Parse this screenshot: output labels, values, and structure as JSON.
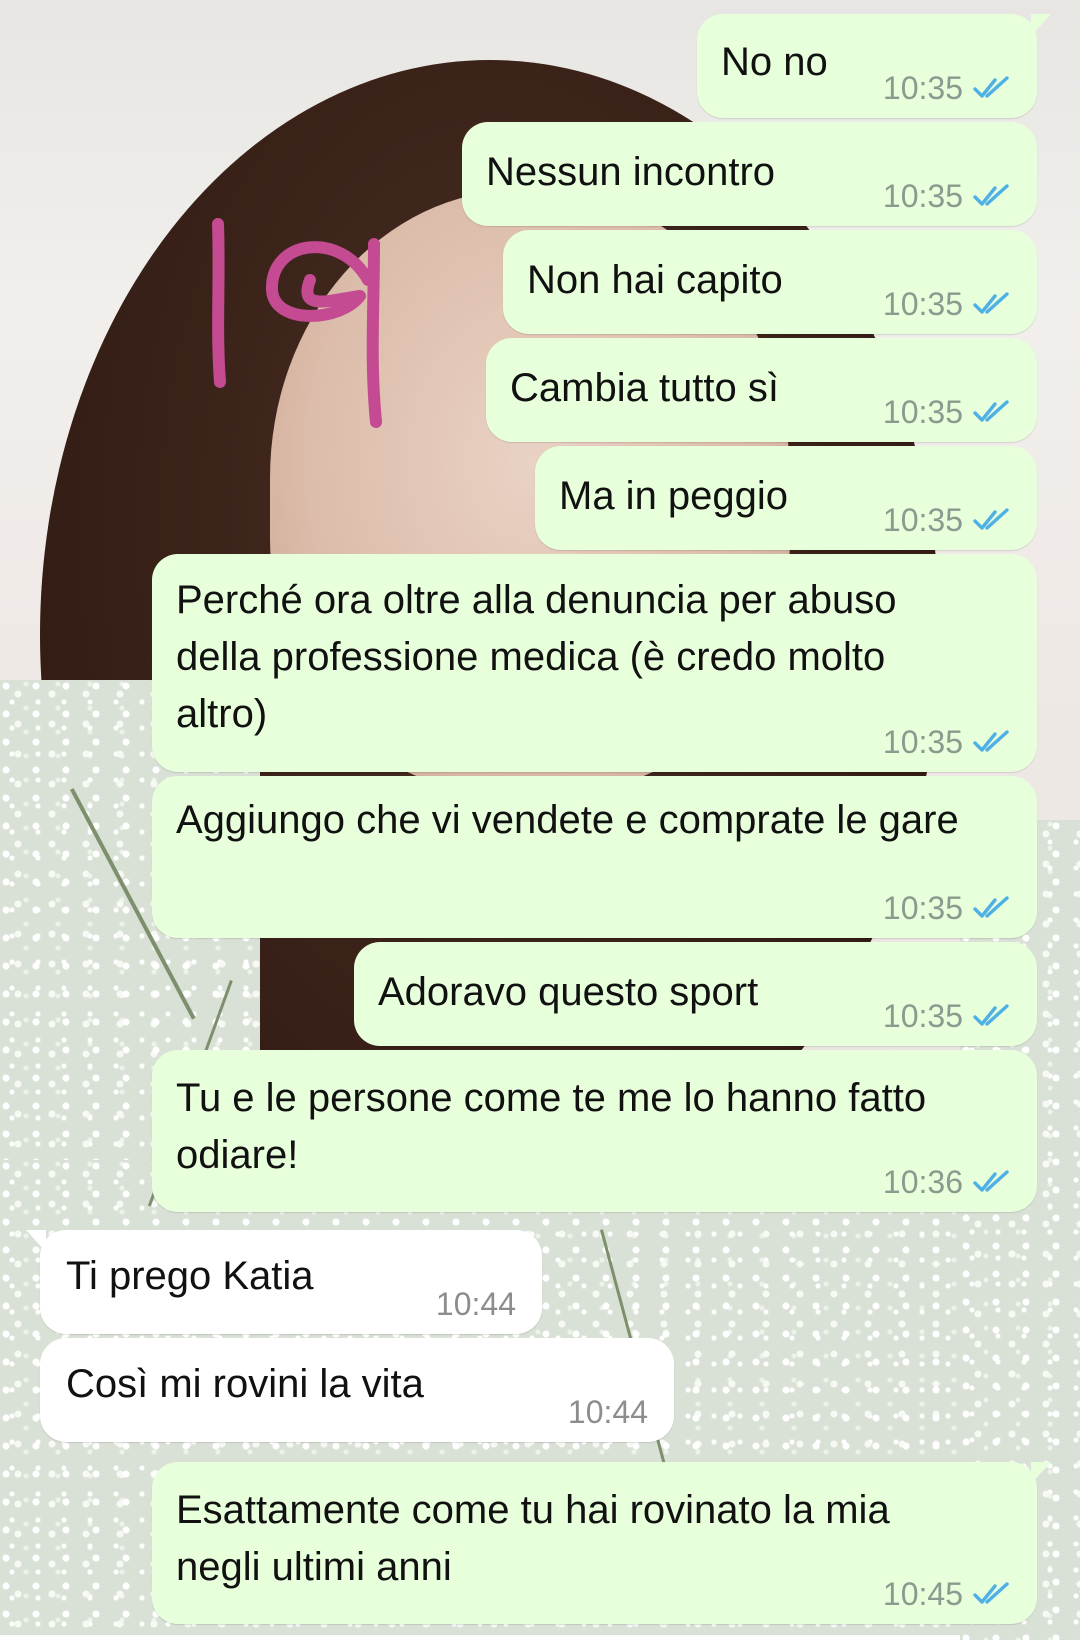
{
  "chat": {
    "sticker_text": "19",
    "colors": {
      "outgoing_bubble": "#e7ffdb",
      "incoming_bubble": "#ffffff",
      "read_ticks": "#4fb0e6",
      "sticker_ink": "#c44a92"
    },
    "messages": [
      {
        "direction": "out",
        "text": "No no",
        "time": "10:35",
        "status": "read-double-check-icon"
      },
      {
        "direction": "out",
        "text": "Nessun incontro",
        "time": "10:35",
        "status": "read-double-check-icon"
      },
      {
        "direction": "out",
        "text": "Non hai capito",
        "time": "10:35",
        "status": "read-double-check-icon"
      },
      {
        "direction": "out",
        "text": "Cambia tutto sì",
        "time": "10:35",
        "status": "read-double-check-icon"
      },
      {
        "direction": "out",
        "text": "Ma in peggio",
        "time": "10:35",
        "status": "read-double-check-icon"
      },
      {
        "direction": "out",
        "text": "Perché ora oltre alla denuncia per abuso della professione medica (è credo molto altro)",
        "time": "10:35",
        "status": "read-double-check-icon"
      },
      {
        "direction": "out",
        "text": "Aggiungo che vi vendete e comprate le gare",
        "time": "10:35",
        "status": "read-double-check-icon"
      },
      {
        "direction": "out",
        "text": "Adoravo questo sport",
        "time": "10:35",
        "status": "read-double-check-icon"
      },
      {
        "direction": "out",
        "text": "Tu e le persone come te me lo hanno fatto odiare!",
        "time": "10:36",
        "status": "read-double-check-icon"
      },
      {
        "direction": "in",
        "text": "Ti prego Katia",
        "time": "10:44"
      },
      {
        "direction": "in",
        "text": "Così mi rovini la vita",
        "time": "10:44"
      },
      {
        "direction": "out",
        "text": "Esattamente come tu hai rovinato la mia negli ultimi anni",
        "time": "10:45",
        "status": "read-double-check-icon"
      }
    ]
  }
}
